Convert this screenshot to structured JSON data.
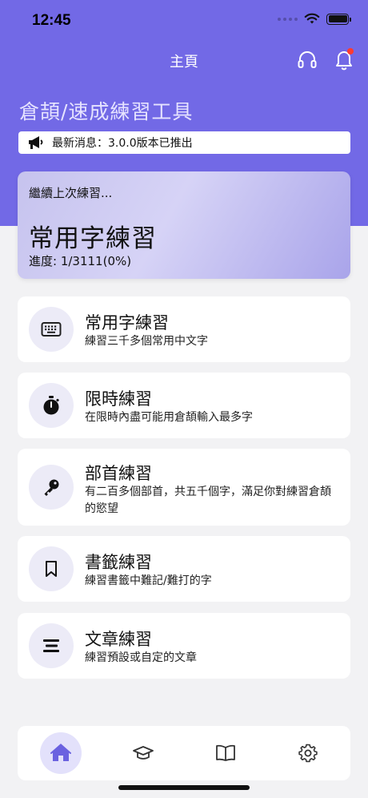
{
  "status_bar": {
    "time": "12:45"
  },
  "nav": {
    "title": "主頁"
  },
  "app_title": "倉頡/速成練習工具",
  "news": {
    "text": "最新消息：3.0.0版本已推出"
  },
  "continue_card": {
    "label": "繼續上次練習...",
    "title": "常用字練習",
    "progress": "進度: 1/3111(0%)"
  },
  "menu": [
    {
      "title": "常用字練習",
      "desc": "練習三千多個常用中文字",
      "icon": "keyboard-icon"
    },
    {
      "title": "限時練習",
      "desc": "在限時內盡可能用倉頡輸入最多字",
      "icon": "stopwatch-icon"
    },
    {
      "title": "部首練習",
      "desc": "有二百多個部首，共五千個字，滿足你對練習倉頡的慾望",
      "icon": "key-icon"
    },
    {
      "title": "書籤練習",
      "desc": "練習書籤中難記/難打的字",
      "icon": "bookmark-icon"
    },
    {
      "title": "文章練習",
      "desc": "練習預設或自定的文章",
      "icon": "text-lines-icon"
    }
  ],
  "tab_bar": {
    "tabs": [
      "home-icon",
      "graduation-cap-icon",
      "book-open-icon",
      "gear-icon"
    ],
    "active": "home-icon"
  },
  "colors": {
    "accent": "#7269e6",
    "icon_bg": "#ecebf7",
    "active_tab_bg": "#e3e1fb"
  }
}
